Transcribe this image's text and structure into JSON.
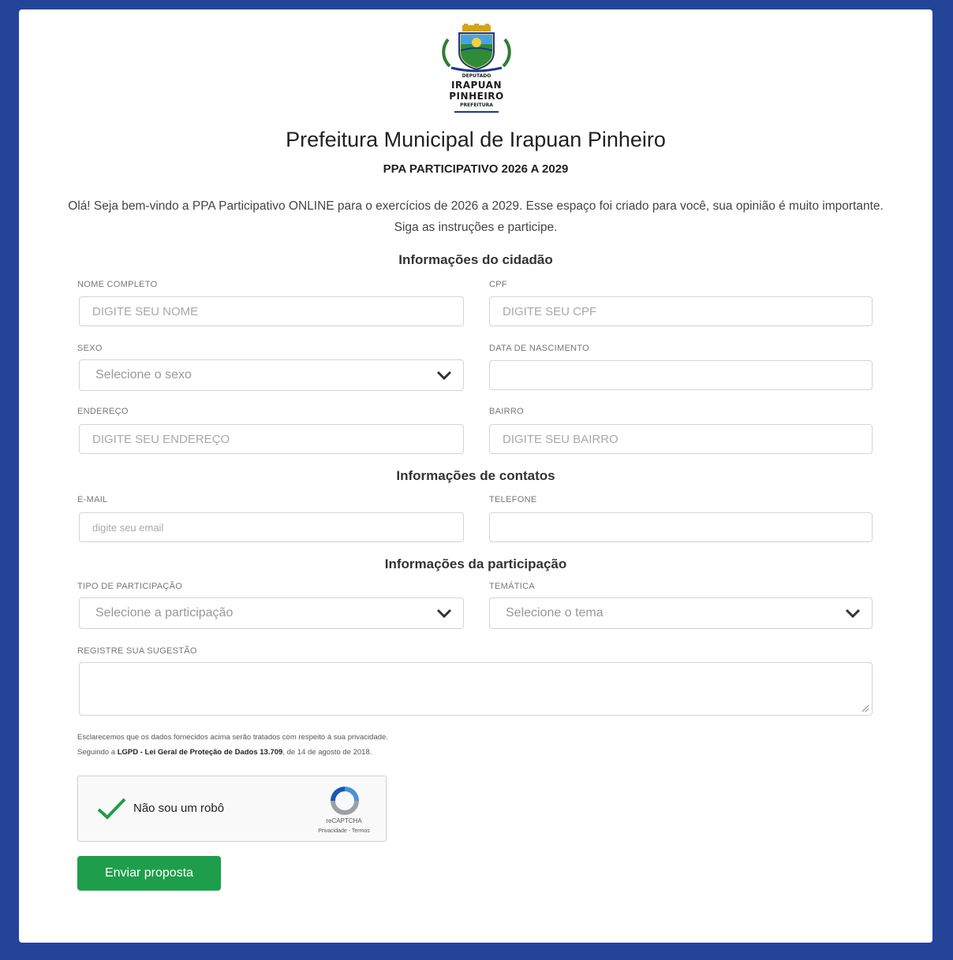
{
  "logo": {
    "line1": "DEPUTADO",
    "line2": "IRAPUAN",
    "line3": "PINHEIRO",
    "line4": "PREFEITURA"
  },
  "header": {
    "title": "Prefeitura Municipal de Irapuan Pinheiro",
    "subtitle": "PPA PARTICIPATIVO 2026 A 2029",
    "intro": "Olá! Seja bem-vindo a PPA Participativo ONLINE para o exercícios de 2026 a 2029. Esse espaço foi criado para você, sua opinião é muito importante. Siga as instruções e participe."
  },
  "sections": {
    "citizen": "Informações do cidadão",
    "contacts": "Informações de contatos",
    "participation": "Informações da participação"
  },
  "fields": {
    "nome": {
      "label": "NOME COMPLETO",
      "placeholder": "DIGITE SEU NOME"
    },
    "cpf": {
      "label": "CPF",
      "placeholder": "DIGITE SEU CPF"
    },
    "sexo": {
      "label": "SEXO",
      "value": "Selecione o sexo"
    },
    "nascimento": {
      "label": "DATA DE NASCIMENTO",
      "placeholder": ""
    },
    "endereco": {
      "label": "ENDEREÇO",
      "placeholder": "DIGITE SEU ENDEREÇO"
    },
    "bairro": {
      "label": "BAIRRO",
      "placeholder": "DIGITE SEU BAIRRO"
    },
    "email": {
      "label": "E-MAIL",
      "placeholder": "digite seu email"
    },
    "telefone": {
      "label": "TELEFONE",
      "placeholder": ""
    },
    "tipo": {
      "label": "TIPO DE PARTICIPAÇÃO",
      "value": "Selecione a participação"
    },
    "tematica": {
      "label": "TEMÁTICA",
      "value": "Selecione o tema"
    },
    "sugestao": {
      "label": "REGISTRE SUA SUGESTÃO"
    }
  },
  "privacy": {
    "line1": "Esclarecemos que os dados fornecidos acima serão tratados com respeito à sua privacidade.",
    "line2_prefix": "Seguindo a ",
    "line2_bold": "LGPD - Lei Geral de Proteção de Dados 13.709",
    "line2_suffix": ", de 14 de agosto de 2018."
  },
  "captcha": {
    "label": "Não sou um robô",
    "brand": "reCAPTCHA",
    "links": "Privacidade - Termos"
  },
  "submit": {
    "label": "Enviar proposta"
  },
  "colors": {
    "background": "#24449a",
    "button": "#1e9e4a",
    "check": "#1e9e4a"
  }
}
